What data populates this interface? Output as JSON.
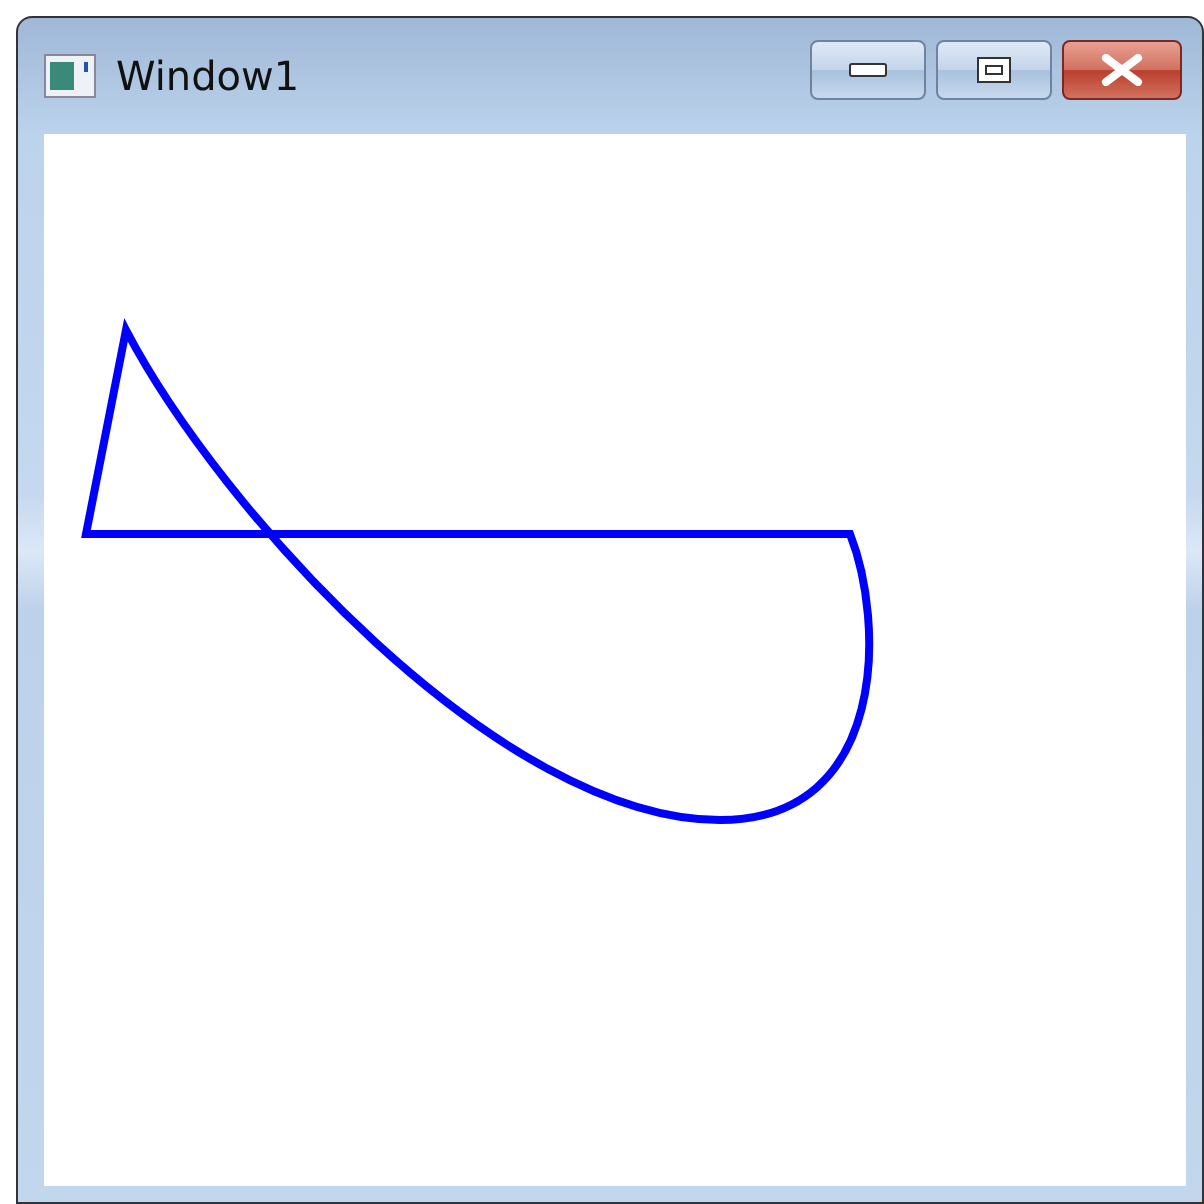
{
  "window": {
    "title": "Window1"
  }
}
